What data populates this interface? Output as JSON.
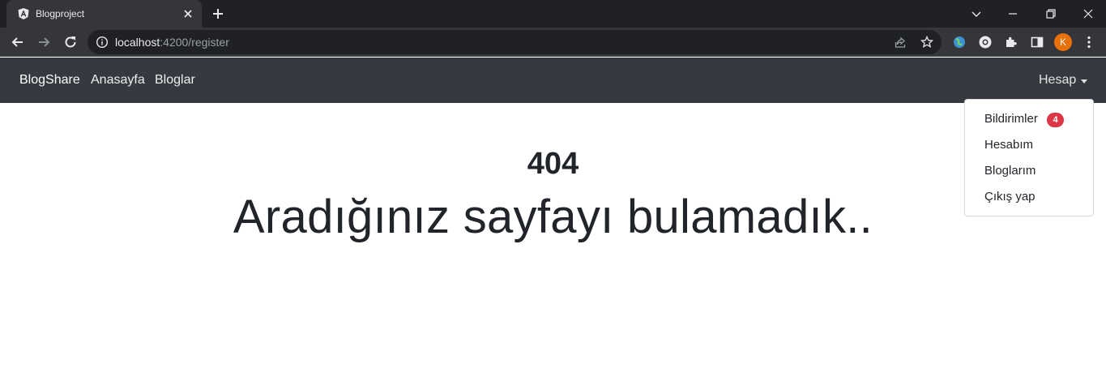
{
  "browser": {
    "tab_title": "Blogproject",
    "url_host": "localhost",
    "url_rest": ":4200/register",
    "profile_initial": "K"
  },
  "navbar": {
    "brand": "BlogShare",
    "links": [
      "Anasayfa",
      "Bloglar"
    ],
    "account_label": "Hesap"
  },
  "dropdown": {
    "items": [
      "Bildirimler",
      "Hesabım",
      "Bloglarım",
      "Çıkış yap"
    ],
    "notification_count": "4"
  },
  "page": {
    "error_code": "404",
    "error_message": "Aradığınız sayfayı bulamadık.."
  },
  "colors": {
    "navbar_bg": "#343a40",
    "badge_bg": "#dc3545",
    "avatar_bg": "#e8710a"
  }
}
